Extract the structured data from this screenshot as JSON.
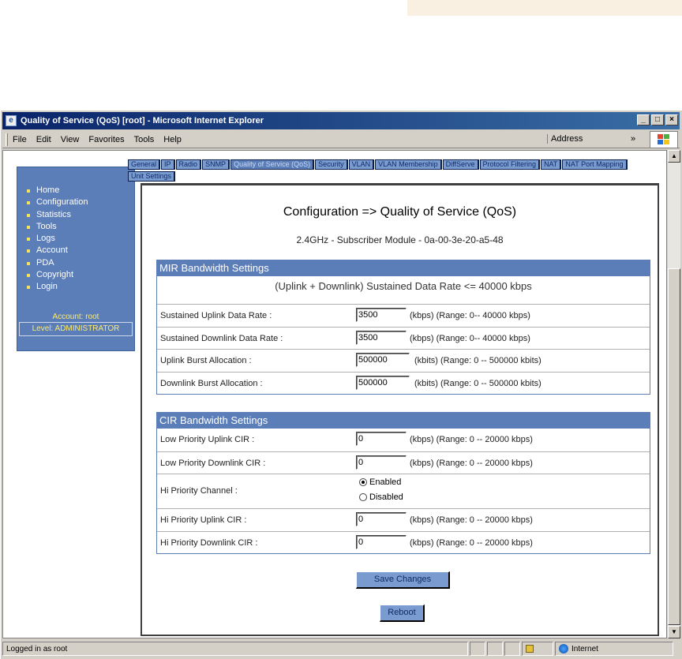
{
  "window": {
    "title": "Quality of Service (QoS) [root] - Microsoft Internet Explorer",
    "controls": [
      "_",
      "□",
      "×"
    ]
  },
  "menubar": {
    "items": [
      "File",
      "Edit",
      "View",
      "Favorites",
      "Tools",
      "Help"
    ],
    "address_label": "Address",
    "chevron": "»"
  },
  "sidebar": {
    "items": [
      "Home",
      "Configuration",
      "Statistics",
      "Tools",
      "Logs",
      "Account",
      "PDA",
      "Copyright",
      "Login"
    ],
    "account_line": "Account: root",
    "level_line": "Level: ADMINISTRATOR"
  },
  "tabs": [
    {
      "label": "General",
      "active": false
    },
    {
      "label": "IP",
      "active": false
    },
    {
      "label": "Radio",
      "active": false
    },
    {
      "label": "SNMP",
      "active": false
    },
    {
      "label": "Quality of Service (QoS)",
      "active": true
    },
    {
      "label": "Security",
      "active": false
    },
    {
      "label": "VLAN",
      "active": false
    },
    {
      "label": "VLAN Membership",
      "active": false
    },
    {
      "label": "DiffServe",
      "active": false
    },
    {
      "label": "Protocol Filtering",
      "active": false
    },
    {
      "label": "NAT",
      "active": false
    },
    {
      "label": "NAT Port Mapping",
      "active": false
    },
    {
      "label": "Unit Settings",
      "active": false
    }
  ],
  "page": {
    "title": "Configuration => Quality of Service (QoS)",
    "subtitle": "2.4GHz - Subscriber Module - 0a-00-3e-20-a5-48"
  },
  "mir": {
    "header": "MIR Bandwidth Settings",
    "note": "(Uplink + Downlink) Sustained Data Rate <= 40000  kbps",
    "rows": [
      {
        "label": "Sustained Uplink Data Rate :",
        "value": "3500",
        "hint": "(kbps) (Range: 0-- 40000 kbps)"
      },
      {
        "label": "Sustained Downlink Data Rate :",
        "value": "3500",
        "hint": "(kbps) (Range: 0-- 40000 kbps)"
      },
      {
        "label": "Uplink Burst Allocation :",
        "value": "500000",
        "hint": "(kbits) (Range: 0 -- 500000 kbits)"
      },
      {
        "label": "Downlink Burst Allocation :",
        "value": "500000",
        "hint": "(kbits) (Range: 0 -- 500000 kbits)"
      }
    ]
  },
  "cir": {
    "header": "CIR Bandwidth Settings",
    "rows": [
      {
        "label": "Low Priority Uplink CIR :",
        "value": "0",
        "hint": "(kbps) (Range: 0 -- 20000 kbps)"
      },
      {
        "label": "Low Priority Downlink CIR :",
        "value": "0",
        "hint": "(kbps) (Range: 0 -- 20000 kbps)"
      }
    ],
    "hi_channel": {
      "label": "Hi Priority Channel :",
      "enabled_label": "Enabled",
      "disabled_label": "Disabled",
      "selected": "Enabled"
    },
    "hi_rows": [
      {
        "label": "Hi Priority Uplink CIR :",
        "value": "0",
        "hint": "(kbps) (Range: 0 -- 20000 kbps)"
      },
      {
        "label": "Hi Priority Downlink CIR :",
        "value": "0",
        "hint": "(kbps) (Range: 0 -- 20000 kbps)"
      }
    ]
  },
  "buttons": {
    "save": "Save Changes",
    "reboot": "Reboot"
  },
  "statusbar": {
    "text": "Logged in as root",
    "zone": "Internet"
  }
}
